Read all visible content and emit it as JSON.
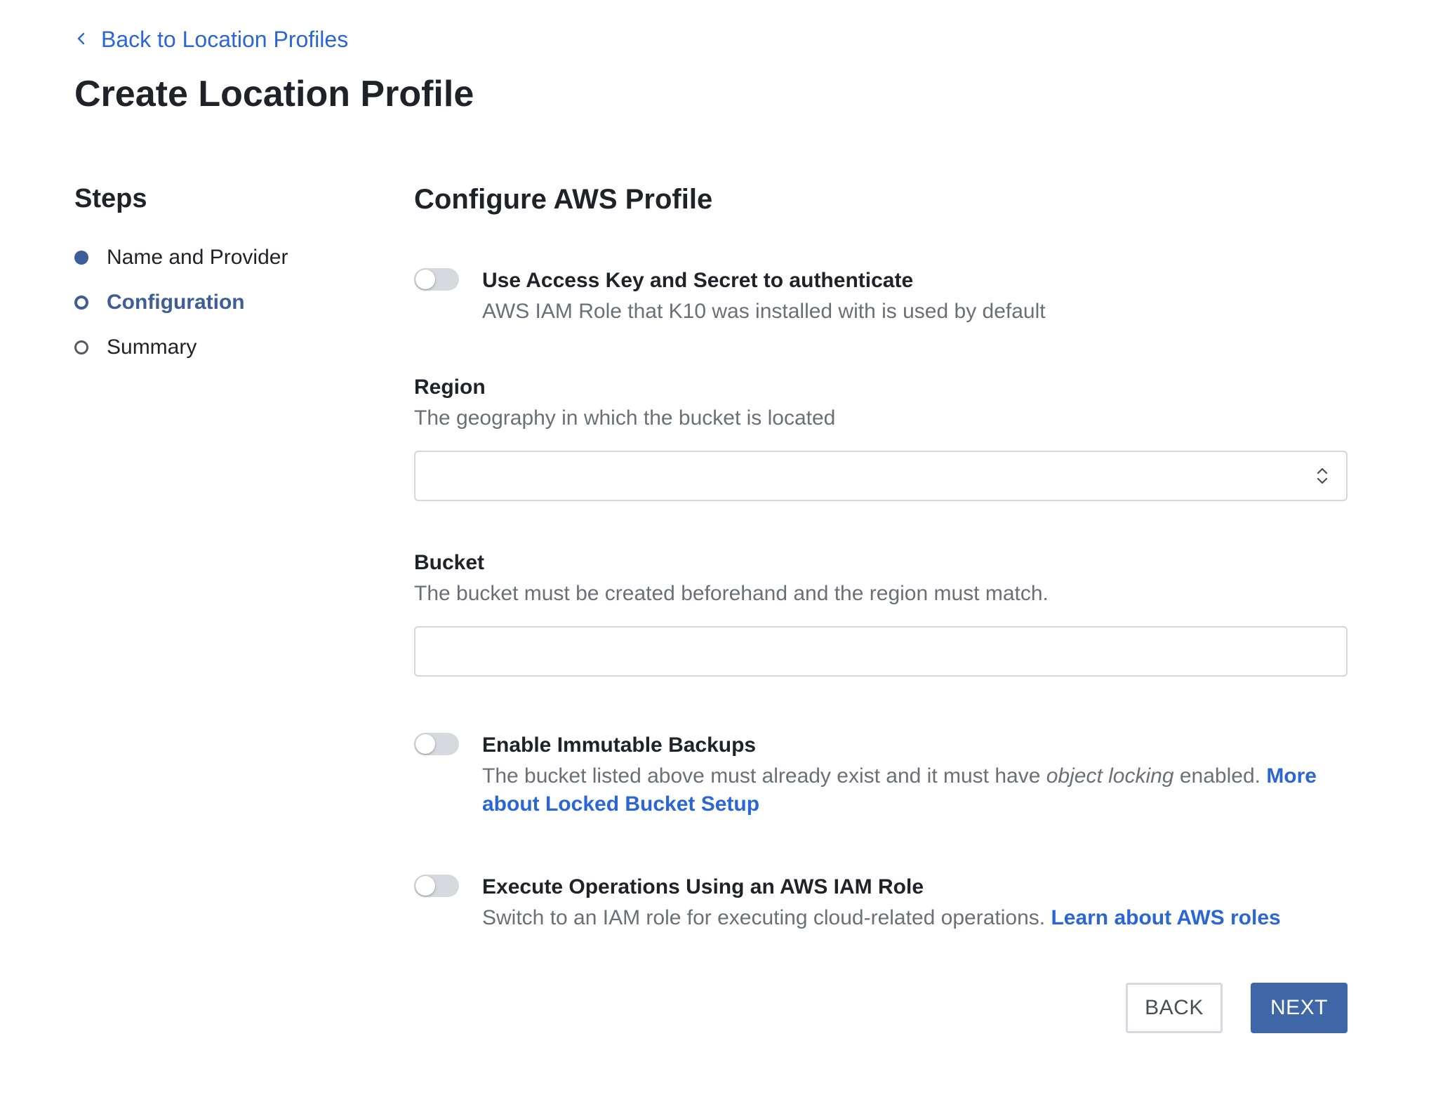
{
  "header": {
    "back_link": "Back to Location Profiles",
    "title": "Create Location Profile"
  },
  "steps": {
    "heading": "Steps",
    "items": [
      {
        "label": "Name and Provider",
        "state": "done"
      },
      {
        "label": "Configuration",
        "state": "active"
      },
      {
        "label": "Summary",
        "state": "pending"
      }
    ]
  },
  "main": {
    "section_title": "Configure AWS Profile",
    "access_key_toggle": {
      "label": "Use Access Key and Secret to authenticate",
      "description": "AWS IAM Role that K10 was installed with is used by default",
      "enabled": false
    },
    "region": {
      "label": "Region",
      "description": "The geography in which the bucket is located",
      "value": ""
    },
    "bucket": {
      "label": "Bucket",
      "description": "The bucket must be created beforehand and the region must match.",
      "value": "",
      "placeholder": ""
    },
    "immutable_toggle": {
      "label": "Enable Immutable Backups",
      "description_pre": "The bucket listed above must already exist and it must have ",
      "description_em": "object locking",
      "description_post": " enabled. ",
      "link": "More about Locked Bucket Setup",
      "enabled": false
    },
    "iam_role_toggle": {
      "label": "Execute Operations Using an AWS IAM Role",
      "description": "Switch to an IAM role for executing cloud-related operations. ",
      "link": "Learn about AWS roles",
      "enabled": false
    },
    "buttons": {
      "back": "BACK",
      "next": "NEXT"
    }
  },
  "colors": {
    "accent": "#3f67a8",
    "link": "#2a66d8",
    "muted_text": "#6b7078",
    "toggle_off": "#d6d9de"
  }
}
